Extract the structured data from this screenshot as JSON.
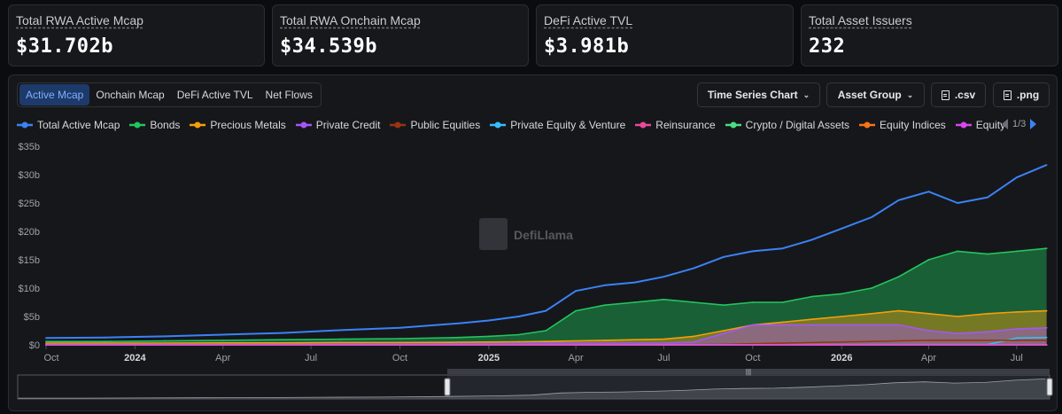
{
  "stats": [
    {
      "label": "Total RWA Active Mcap",
      "value": "$31.702b"
    },
    {
      "label": "Total RWA Onchain Mcap",
      "value": "$34.539b"
    },
    {
      "label": "DeFi Active TVL",
      "value": "$3.981b"
    },
    {
      "label": "Total Asset Issuers",
      "value": "232"
    }
  ],
  "tabs": [
    {
      "label": "Active Mcap",
      "active": true
    },
    {
      "label": "Onchain Mcap",
      "active": false
    },
    {
      "label": "DeFi Active TVL",
      "active": false
    },
    {
      "label": "Net Flows",
      "active": false
    }
  ],
  "controls": {
    "chart_type": "Time Series Chart",
    "group_by": "Asset Group",
    "csv": ".csv",
    "png": ".png",
    "legend_page": "1/3"
  },
  "watermark": "DefiLlama",
  "chart_data": {
    "type": "area",
    "x": [
      "2023-10-01",
      "2023-12-01",
      "2024-02-01",
      "2024-04-01",
      "2024-06-01",
      "2024-08-01",
      "2024-10-01",
      "2024-12-01",
      "2025-01-01",
      "2025-02-01",
      "2025-03-01",
      "2025-04-01",
      "2025-05-01",
      "2025-06-01",
      "2025-07-01",
      "2025-08-01",
      "2025-09-01",
      "2025-10-01",
      "2025-11-01",
      "2025-12-01",
      "2026-01-01",
      "2026-02-01",
      "2026-03-01",
      "2026-04-01",
      "2026-05-01",
      "2026-06-01",
      "2026-07-01",
      "2026-08-01"
    ],
    "x_ticks": [
      "Oct",
      "2024",
      "Apr",
      "Jul",
      "Oct",
      "2025",
      "Apr",
      "Jul",
      "Oct",
      "2026",
      "Apr",
      "Jul"
    ],
    "y_ticks": [
      "$0",
      "$5b",
      "$10b",
      "$15b",
      "$20b",
      "$25b",
      "$30b",
      "$35b"
    ],
    "ylim": [
      0,
      35
    ],
    "y_unit": "billion USD",
    "legend_position": "top",
    "grid": false,
    "series": [
      {
        "name": "Total Active Mcap",
        "color": "#3b82f6",
        "fill": false,
        "values": [
          1.2,
          1.3,
          1.5,
          1.8,
          2.1,
          2.6,
          3.0,
          3.8,
          4.3,
          5.0,
          6.0,
          9.5,
          10.5,
          11.0,
          12.0,
          13.5,
          15.5,
          16.5,
          17.0,
          18.5,
          20.5,
          22.5,
          25.5,
          27.0,
          25.0,
          26.0,
          29.5,
          31.7
        ]
      },
      {
        "name": "Bonds",
        "color": "#22c55e",
        "fill": true,
        "values": [
          0.6,
          0.6,
          0.7,
          0.8,
          0.9,
          1.0,
          1.1,
          1.3,
          1.5,
          1.8,
          2.5,
          6.0,
          7.0,
          7.5,
          8.0,
          7.5,
          7.0,
          7.5,
          7.5,
          8.5,
          9.0,
          10.0,
          12.0,
          15.0,
          16.5,
          16.0,
          16.5,
          17.0
        ]
      },
      {
        "name": "Precious Metals",
        "color": "#f59e0b",
        "fill": true,
        "values": [
          0.3,
          0.3,
          0.3,
          0.35,
          0.35,
          0.4,
          0.4,
          0.45,
          0.5,
          0.55,
          0.6,
          0.7,
          0.8,
          0.9,
          1.0,
          1.5,
          2.5,
          3.5,
          4.0,
          4.5,
          5.0,
          5.5,
          6.0,
          5.5,
          5.0,
          5.5,
          5.8,
          6.0
        ]
      },
      {
        "name": "Private Credit",
        "color": "#a855f7",
        "fill": true,
        "values": [
          0.1,
          0.1,
          0.1,
          0.1,
          0.1,
          0.15,
          0.15,
          0.2,
          0.2,
          0.25,
          0.3,
          0.3,
          0.3,
          0.3,
          0.3,
          0.5,
          2.0,
          3.5,
          3.5,
          3.5,
          3.5,
          3.5,
          3.5,
          2.5,
          2.0,
          2.3,
          2.8,
          3.0
        ]
      },
      {
        "name": "Public Equities",
        "color": "#9a3412",
        "fill": false,
        "values": [
          0.05,
          0.05,
          0.05,
          0.05,
          0.05,
          0.05,
          0.05,
          0.05,
          0.05,
          0.05,
          0.05,
          0.05,
          0.05,
          0.05,
          0.05,
          0.05,
          0.1,
          0.2,
          0.3,
          0.4,
          0.5,
          0.6,
          0.7,
          0.8,
          0.8,
          0.8,
          0.8,
          0.8
        ]
      },
      {
        "name": "Private Equity & Venture",
        "color": "#38bdf8",
        "fill": false,
        "values": [
          0.05,
          0.05,
          0.05,
          0.05,
          0.05,
          0.05,
          0.05,
          0.05,
          0.05,
          0.05,
          0.05,
          0.05,
          0.05,
          0.05,
          0.05,
          0.05,
          0.05,
          0.05,
          0.05,
          0.05,
          0.05,
          0.05,
          0.05,
          0.05,
          0.05,
          0.05,
          1.2,
          1.3
        ]
      },
      {
        "name": "Reinsurance",
        "color": "#ec4899",
        "fill": false,
        "values": [
          0,
          0,
          0,
          0,
          0,
          0,
          0,
          0,
          0,
          0,
          0,
          0,
          0,
          0,
          0,
          0,
          0,
          0,
          0,
          0,
          0,
          0,
          0,
          0,
          0,
          0,
          0,
          0
        ]
      },
      {
        "name": "Crypto / Digital Assets",
        "color": "#4ade80",
        "fill": false,
        "values": [
          0,
          0,
          0,
          0,
          0,
          0,
          0,
          0,
          0,
          0,
          0,
          0,
          0,
          0,
          0,
          0,
          0,
          0,
          0,
          0,
          0,
          0,
          0,
          0,
          0,
          0,
          0,
          0
        ]
      },
      {
        "name": "Equity Indices",
        "color": "#f97316",
        "fill": false,
        "values": [
          0,
          0,
          0,
          0,
          0,
          0,
          0,
          0,
          0,
          0,
          0,
          0,
          0,
          0,
          0,
          0,
          0,
          0,
          0,
          0,
          0,
          0,
          0,
          0,
          0,
          0,
          0,
          0
        ]
      },
      {
        "name": "Equity",
        "color": "#d946ef",
        "fill": false,
        "values": [
          0,
          0,
          0,
          0,
          0,
          0,
          0,
          0,
          0,
          0,
          0,
          0,
          0,
          0,
          0,
          0,
          0,
          0,
          0,
          0,
          0,
          0,
          0,
          0,
          0,
          0,
          0,
          0
        ]
      }
    ]
  }
}
